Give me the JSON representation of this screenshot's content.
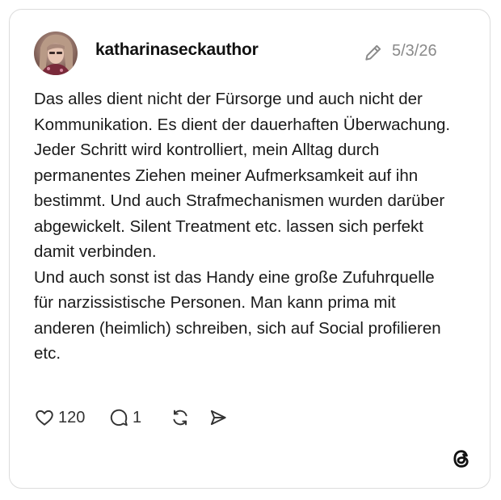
{
  "post": {
    "username": "katharinaseckauthor",
    "date": "5/3/26",
    "text": "Das alles dient nicht der Fürsorge und auch nicht der Kommunikation. Es dient der dauerhaften Überwachung. Jeder Schritt wird kontrolliert, mein Alltag durch permanentes Ziehen meiner Aufmerksamkeit auf ihn bestimmt. Und auch Strafmechanismen wurden darüber abgewickelt. Silent Treatment etc. lassen sich perfekt damit verbinden.\nUnd auch sonst ist das Handy eine große Zufuhrquelle für narzissistische Personen. Man kann prima mit anderen (heimlich) schreiben, sich auf Social profilieren etc."
  },
  "actions": {
    "likes": "120",
    "replies": "1"
  },
  "icons": {
    "edit": "pencil-icon",
    "like": "heart-icon",
    "reply": "comment-icon",
    "repost": "repost-icon",
    "share": "send-icon",
    "brand": "threads-logo"
  },
  "colors": {
    "border": "#dcdcdc",
    "muted": "#8a8a8a",
    "text": "#1a1a1a"
  }
}
